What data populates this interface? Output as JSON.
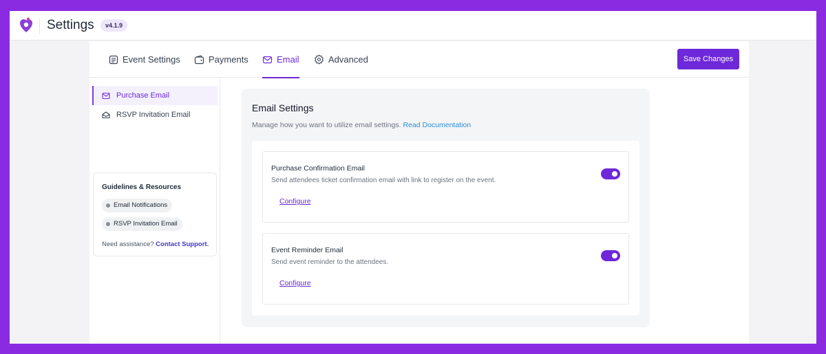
{
  "app": {
    "title": "Settings",
    "version": "v4.1.9",
    "brand_color": "#8a2be2",
    "accent_color": "#6d28d9"
  },
  "tabs": [
    {
      "label": "Event Settings",
      "icon": "event-settings-icon",
      "active": false
    },
    {
      "label": "Payments",
      "icon": "payments-icon",
      "active": false
    },
    {
      "label": "Email",
      "icon": "mail-icon",
      "active": true
    },
    {
      "label": "Advanced",
      "icon": "gear-icon",
      "active": false
    }
  ],
  "toolbar": {
    "save_label": "Save Changes"
  },
  "sidebar": {
    "items": [
      {
        "label": "Purchase Email",
        "icon": "mail-icon",
        "active": true
      },
      {
        "label": "RSVP Invitation Email",
        "icon": "mail-open-icon",
        "active": false
      }
    ],
    "guide": {
      "title": "Guidelines & Resources",
      "chips": [
        "Email Notifications",
        "RSVP Invitation Email"
      ],
      "assist_text": "Need assistance?",
      "assist_link": "Contact Support."
    }
  },
  "email_settings": {
    "title": "Email Settings",
    "description": "Manage how you want to utilize email settings.",
    "doc_link": "Read Documentation",
    "items": [
      {
        "title": "Purchase Confirmation Email",
        "description": "Send attendees ticket confirmation email with link to register on the event.",
        "configure_label": "Configure",
        "enabled": true
      },
      {
        "title": "Event Reminder Email",
        "description": "Send event reminder to the attendees.",
        "configure_label": "Configure",
        "enabled": true
      }
    ]
  }
}
